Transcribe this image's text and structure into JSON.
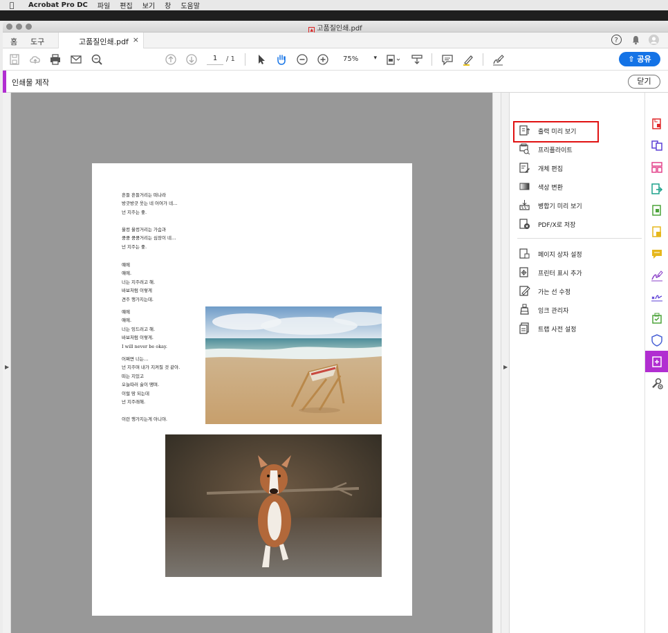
{
  "menubar": {
    "app_name": "Acrobat Pro DC",
    "items": [
      "파일",
      "편집",
      "보기",
      "창",
      "도움말"
    ]
  },
  "window": {
    "title": "고품질인쇄.pdf"
  },
  "tabs": {
    "home": "홈",
    "tools": "도구",
    "document": "고품질인쇄.pdf",
    "close_symbol": "×"
  },
  "toolbar": {
    "page_current": "1",
    "page_total": "/ 1",
    "zoom": "75%",
    "share_label": "공유"
  },
  "panel": {
    "title": "인쇄물 제작",
    "close_label": "닫기"
  },
  "document": {
    "poem_block1": "흔들 흔들거리는 떠나라\n방긋방긋 웃는 네 어여가 네…\n넌 지주는 좋.",
    "poem_block2": "울컹 울컹거리는 가슴과\n쿵쿵 쿵쿵거리는 심장이 네…\n넌 지주는 좋.",
    "poem_block3": "얘에\n얘에.\n너는 지주려고 해.\n바보처럼 이렇게\n견주 행가지는데.",
    "poem_block4": "얘에\n얘에.\n너는 잉드러고 해.\n바보처럼 이렇게.\nI will never be okay.",
    "poem_block5": "어쩌면 너는…\n넌 지주며 내가 지켜질 것 같아.\n떠는 지있고\n오늘따러 술이 땡며.\n이럴 땅 되는데\n넌 지주래해.",
    "poem_block6": "이런 행가지는게 아니야."
  },
  "tools": [
    {
      "label": "출력 미리 보기",
      "icon": "output-preview-icon"
    },
    {
      "label": "프리플라이트",
      "icon": "preflight-icon"
    },
    {
      "label": "개체 편집",
      "icon": "edit-object-icon"
    },
    {
      "label": "색상 변환",
      "icon": "convert-colors-icon"
    },
    {
      "label": "병합기 미리 보기",
      "icon": "flattener-preview-icon"
    },
    {
      "label": "PDF/X로 저장",
      "icon": "save-pdfx-icon"
    },
    {
      "label": "페이지 상자 설정",
      "icon": "set-page-boxes-icon"
    },
    {
      "label": "프린터 표시 추가",
      "icon": "add-printer-marks-icon"
    },
    {
      "label": "가는 선 수정",
      "icon": "fix-hairlines-icon"
    },
    {
      "label": "잉크 관리자",
      "icon": "ink-manager-icon"
    },
    {
      "label": "트랩 사전 설정",
      "icon": "trap-presets-icon"
    }
  ],
  "colors": {
    "accent_purple": "#b12ed1",
    "share_blue": "#1473e6",
    "highlight_red": "#e01010"
  }
}
